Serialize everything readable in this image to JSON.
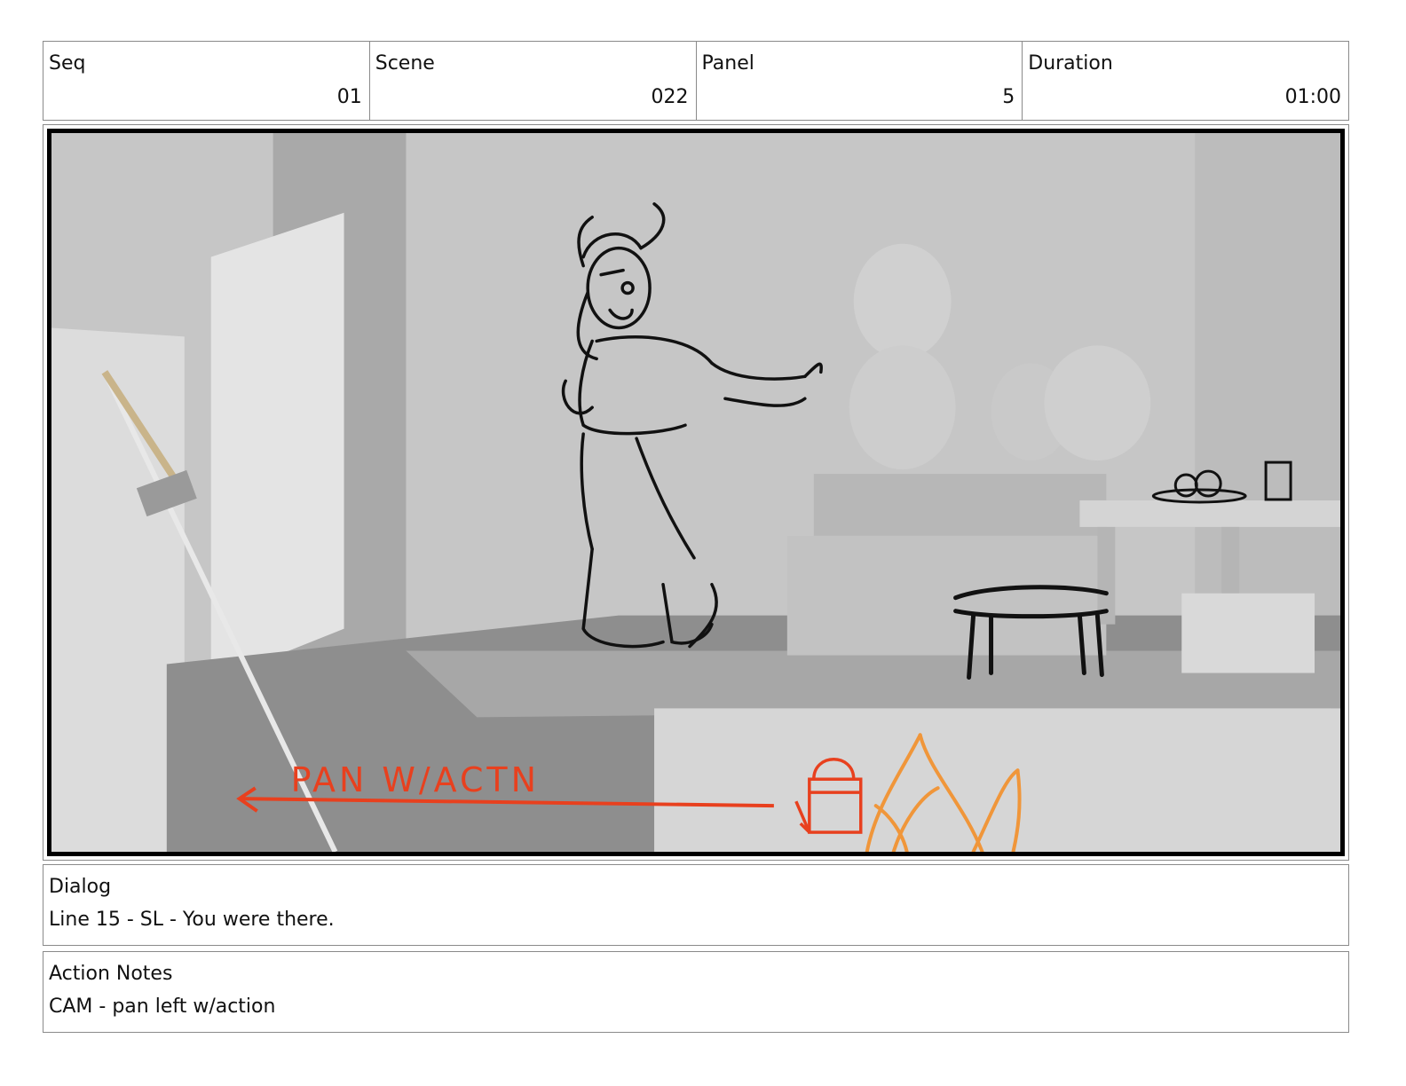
{
  "header": {
    "seq": {
      "label": "Seq",
      "value": "01"
    },
    "scene": {
      "label": "Scene",
      "value": "022"
    },
    "panel": {
      "label": "Panel",
      "value": "5"
    },
    "duration": {
      "label": "Duration",
      "value": "01:00"
    }
  },
  "panel_image": {
    "annotation_text": "PAN W/ACTN",
    "annotation_color": "#e8401e",
    "fire_color": "#f0963a"
  },
  "dialog": {
    "label": "Dialog",
    "text": "Line 15 - SL - You were there."
  },
  "action_notes": {
    "label": "Action Notes",
    "text": "CAM - pan left w/action"
  }
}
